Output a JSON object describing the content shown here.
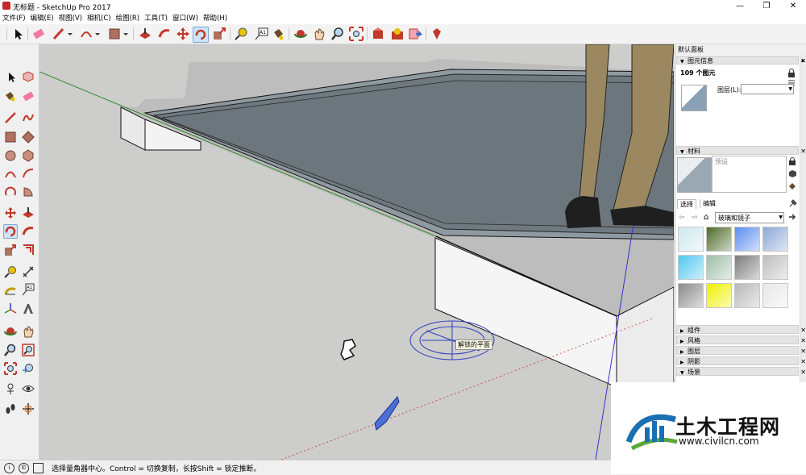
{
  "window": {
    "title": "无标题 - SketchUp Pro 2017",
    "minimize": "—",
    "maximize": "❐",
    "close": "✕"
  },
  "menu": [
    "文件(F)",
    "编辑(E)",
    "视图(V)",
    "相机(C)",
    "绘图(R)",
    "工具(T)",
    "窗口(W)",
    "帮助(H)"
  ],
  "viewport": {
    "tooltip": "解锁的平面"
  },
  "status": {
    "text": "选择量角器中心。Control = 切换复制，长按Shift = 锁定推断。",
    "icon1": "i",
    "icon2": "©"
  },
  "panel": {
    "title": "默认面板",
    "entity_info": {
      "header": "图元信息",
      "count": "109 个图元",
      "layer_label": "图层(L):",
      "layer_value": ""
    },
    "materials": {
      "header": "材料",
      "preset_placeholder": "预设",
      "tab_select": "选择",
      "tab_edit": "编辑",
      "library": "玻璃和镜子"
    },
    "sections": [
      "组件",
      "风格",
      "图层",
      "阴影",
      "场景"
    ]
  },
  "watermark": {
    "brand": "土木工程网",
    "url": "www.civilcn.com"
  },
  "colors": {
    "viewport": "#cdcdcb",
    "glass": "#6f7a80",
    "slab": "#f5f5f5",
    "axis_green": "#2e8b2e",
    "axis_blue": "#3333cc",
    "protractor": "#2d3fbf",
    "brand_blue": "#1a6fb5",
    "brand_green": "#5aa83a"
  },
  "swatches": [
    "#cfe8ef",
    "#4f6b2a",
    "#5b8ef0",
    "#8fa7d8",
    "#4fc7f0",
    "#9fbfa8",
    "#7b7b7b",
    "#bdbdbd",
    "#8a8a8a",
    "#f0f000",
    "#b7b7b7",
    "#e8e8e8"
  ]
}
